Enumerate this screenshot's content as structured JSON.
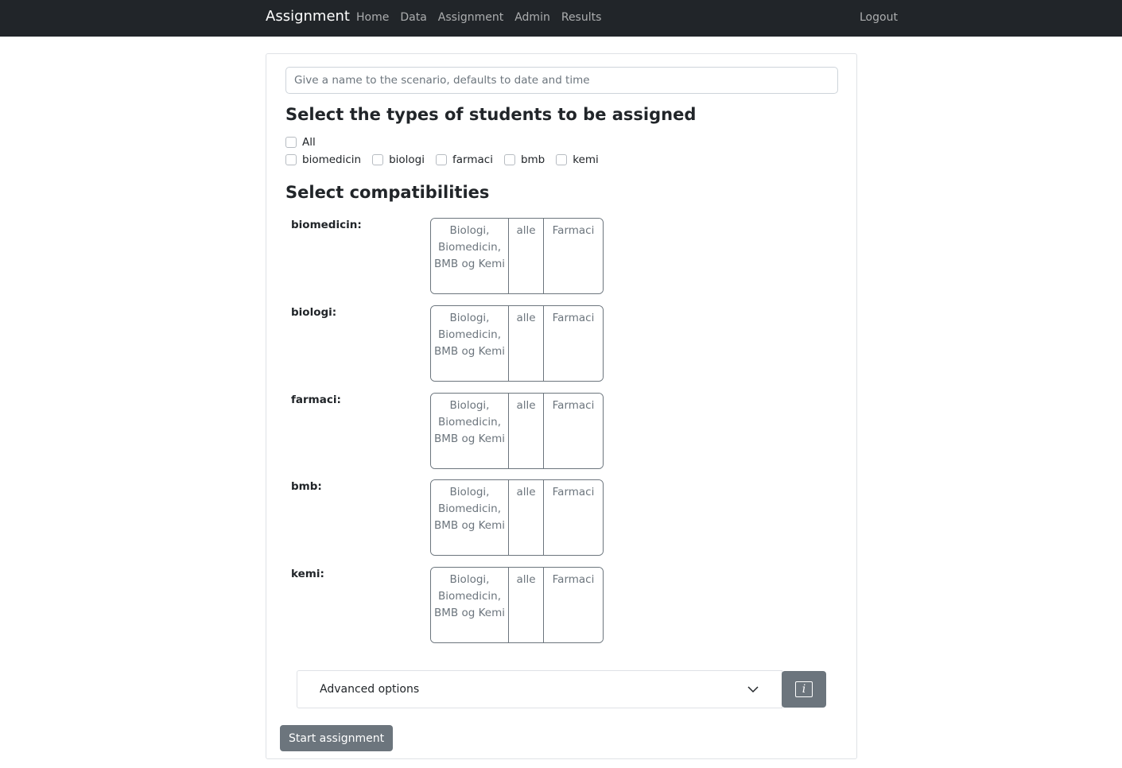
{
  "navbar": {
    "brand": "Assignment",
    "links": [
      "Home",
      "Data",
      "Assignment",
      "Admin",
      "Results"
    ],
    "logout": "Logout"
  },
  "scenario": {
    "placeholder": "Give a name to the scenario, defaults to date and time",
    "value": ""
  },
  "types": {
    "heading": "Select the types of students to be assigned",
    "all_label": "All",
    "options": [
      "biomedicin",
      "biologi",
      "farmaci",
      "bmb",
      "kemi"
    ],
    "checked": []
  },
  "compat": {
    "heading": "Select compatibilities",
    "rows": [
      {
        "label": "biomedicin:",
        "options": [
          "Biologi, Biomedicin, BMB og Kemi",
          "alle",
          "Farmaci"
        ]
      },
      {
        "label": "biologi:",
        "options": [
          "Biologi, Biomedicin, BMB og Kemi",
          "alle",
          "Farmaci"
        ]
      },
      {
        "label": "farmaci:",
        "options": [
          "Biologi, Biomedicin, BMB og Kemi",
          "alle",
          "Farmaci"
        ]
      },
      {
        "label": "bmb:",
        "options": [
          "Biologi, Biomedicin, BMB og Kemi",
          "alle",
          "Farmaci"
        ]
      },
      {
        "label": "kemi:",
        "options": [
          "Biologi, Biomedicin, BMB og Kemi",
          "alle",
          "Farmaci"
        ]
      }
    ]
  },
  "advanced": {
    "label": "Advanced options",
    "icon": "chevron-down-icon",
    "info_icon": "info-icon",
    "info_glyph": "i"
  },
  "start_button": "Start assignment",
  "colors": {
    "navbar": "#212529",
    "secondary": "#6c757d",
    "border": "#dfe2e6"
  }
}
